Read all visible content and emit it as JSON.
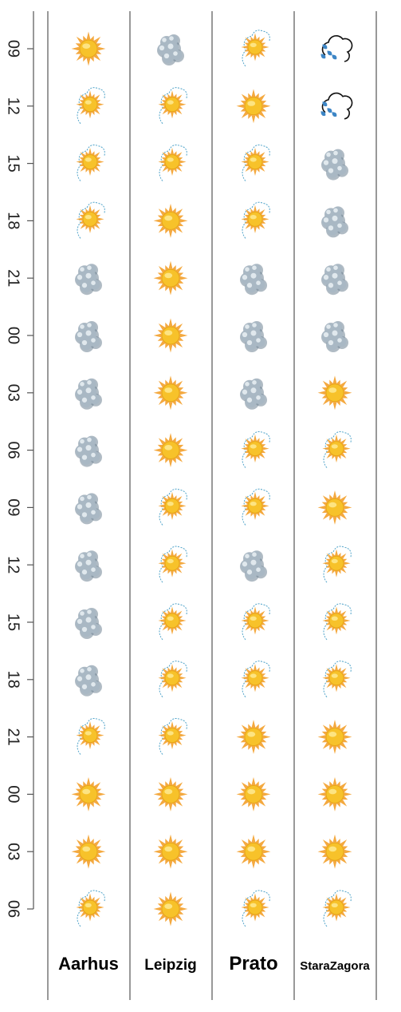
{
  "chart_data": {
    "type": "table",
    "hours": [
      "09",
      "12",
      "15",
      "18",
      "21",
      "00",
      "03",
      "06",
      "09",
      "12",
      "15",
      "18",
      "21",
      "00",
      "03",
      "06"
    ],
    "cities": [
      "Aarhus",
      "Leipzig",
      "Prato",
      "StaraZagora"
    ],
    "conditions": {
      "Aarhus": [
        "sunny",
        "partly-sunny",
        "partly-sunny",
        "partly-sunny",
        "cloudy",
        "cloudy",
        "cloudy",
        "cloudy",
        "cloudy",
        "cloudy",
        "cloudy",
        "cloudy",
        "partly-sunny",
        "sunny",
        "sunny",
        "partly-sunny"
      ],
      "Leipzig": [
        "cloudy",
        "partly-sunny",
        "partly-sunny",
        "sunny",
        "sunny",
        "sunny",
        "sunny",
        "sunny",
        "partly-sunny",
        "partly-sunny",
        "partly-sunny",
        "partly-sunny",
        "partly-sunny",
        "sunny",
        "sunny",
        "sunny"
      ],
      "Prato": [
        "partly-sunny",
        "sunny",
        "partly-sunny",
        "partly-sunny",
        "cloudy",
        "cloudy",
        "cloudy",
        "partly-sunny",
        "partly-sunny",
        "cloudy",
        "partly-sunny",
        "partly-sunny",
        "sunny",
        "sunny",
        "sunny",
        "partly-sunny"
      ],
      "StaraZagora": [
        "rain",
        "rain",
        "cloudy",
        "cloudy",
        "cloudy",
        "cloudy",
        "sunny",
        "partly-sunny",
        "sunny",
        "partly-sunny",
        "partly-sunny",
        "partly-sunny",
        "sunny",
        "sunny",
        "sunny",
        "partly-sunny"
      ]
    },
    "colors": {
      "sun": "#f7c22a",
      "sun_ray": "#f29a1f",
      "cloud": "#a9b8c4",
      "cloud_dark": "#6f8494",
      "rain_drop": "#3d86c6",
      "axis": "#555555"
    }
  }
}
